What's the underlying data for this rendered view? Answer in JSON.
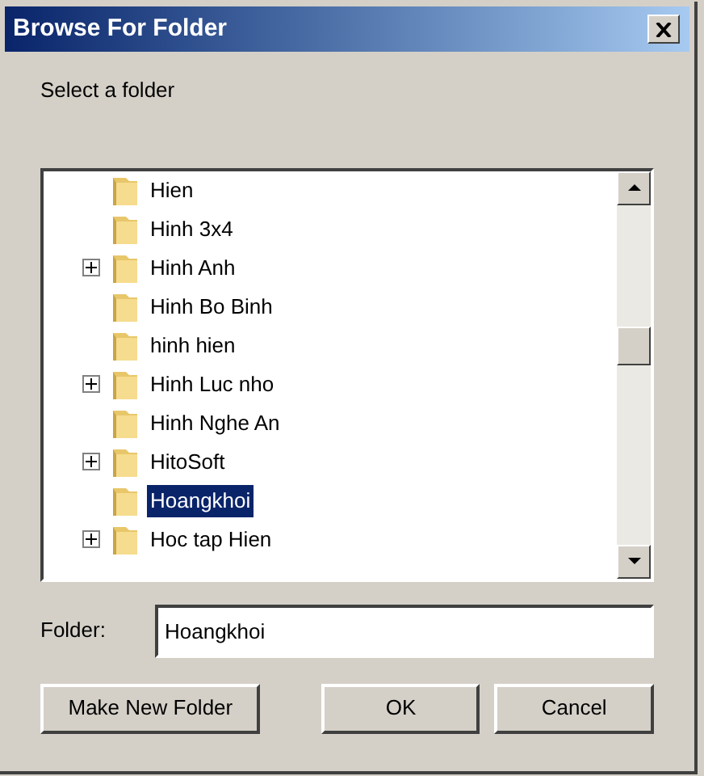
{
  "window": {
    "title": "Browse For Folder"
  },
  "prompt": "Select a folder",
  "tree": {
    "items": [
      {
        "label": "Hien",
        "expandable": false,
        "selected": false
      },
      {
        "label": "Hinh 3x4",
        "expandable": false,
        "selected": false
      },
      {
        "label": "Hinh Anh",
        "expandable": true,
        "selected": false
      },
      {
        "label": "Hinh Bo Binh",
        "expandable": false,
        "selected": false
      },
      {
        "label": "hinh hien",
        "expandable": false,
        "selected": false
      },
      {
        "label": "Hinh Luc nho",
        "expandable": true,
        "selected": false
      },
      {
        "label": "Hinh Nghe An",
        "expandable": false,
        "selected": false
      },
      {
        "label": "HitoSoft",
        "expandable": true,
        "selected": false
      },
      {
        "label": "Hoangkhoi",
        "expandable": false,
        "selected": true
      },
      {
        "label": "Hoc tap Hien",
        "expandable": true,
        "selected": false
      }
    ]
  },
  "folder_field": {
    "label": "Folder:",
    "value": "Hoangkhoi"
  },
  "buttons": [
    {
      "label": "Make New Folder"
    },
    {
      "label": "OK"
    },
    {
      "label": "Cancel"
    }
  ]
}
